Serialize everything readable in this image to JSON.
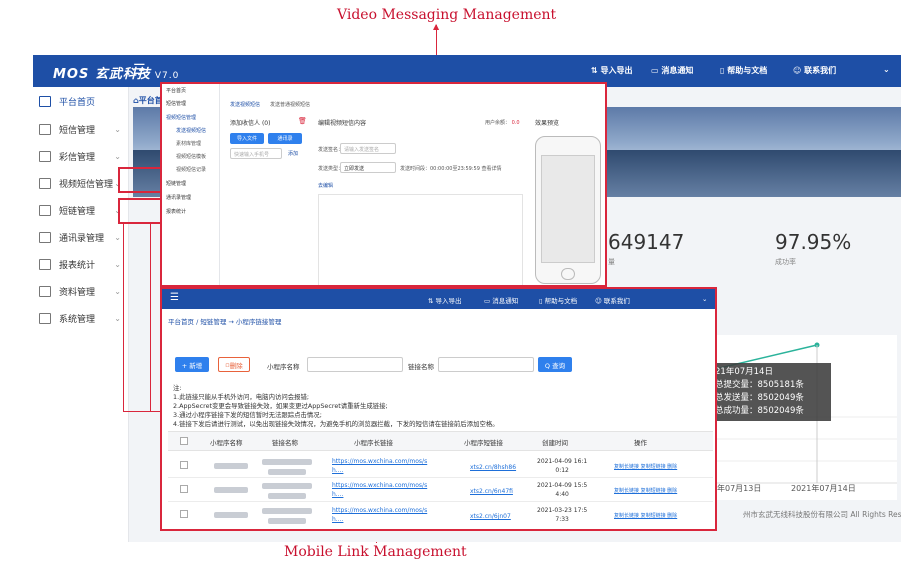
{
  "annotations": {
    "top": "Video Messaging Management",
    "bottom": "Mobile Link Management"
  },
  "app": {
    "logo": "MOS 玄武科技",
    "version": "V7.0",
    "topbar": {
      "export": "导入导出",
      "notice": "消息通知",
      "help": "帮助与文档",
      "contact": "联系我们"
    },
    "sidebar": [
      {
        "label": "平台首页",
        "icon": "home-icon"
      },
      {
        "label": "短信管理",
        "icon": "mail-icon"
      },
      {
        "label": "彩信管理",
        "icon": "image-icon"
      },
      {
        "label": "视频短信管理",
        "icon": "video-icon"
      },
      {
        "label": "短链管理",
        "icon": "link-icon"
      },
      {
        "label": "通讯录管理",
        "icon": "contacts-icon"
      },
      {
        "label": "报表统计",
        "icon": "report-icon"
      },
      {
        "label": "资料管理",
        "icon": "book-icon"
      },
      {
        "label": "系统管理",
        "icon": "folder-icon"
      }
    ],
    "breadcrumb": "平台首",
    "stats": [
      {
        "value": "649147",
        "label": "量"
      },
      {
        "value": "97.95%",
        "label": "成功率"
      }
    ],
    "tooltip": {
      "date": "21年07月14日",
      "sent_total": "总提交量：8505181条",
      "sent": "总发送量：8502049条",
      "success": "总成功量：8502049条"
    },
    "xticks": [
      "年07月13日",
      "2021年07月14日"
    ],
    "footer": "州市玄武无线科技股份有限公司 All Rights Reserved"
  },
  "video_panel": {
    "sidebar": [
      "平台首页",
      "短信管理",
      "视频短信管理",
      "发送视频短信",
      "素材库管理",
      "视频短信模板",
      "视频短信记录",
      "短链管理",
      "通讯录管理",
      "报表统计"
    ],
    "tabs": [
      "发送视频短信",
      "发送普通视频短信"
    ],
    "recipient_title": "添加收信人",
    "recipient_count": "(0)",
    "import_btn": "导入文件",
    "add_btn": "通讯录",
    "recipient_placeholder": "快速输入手机号",
    "recipient_add": "添加",
    "content_title": "编辑视频短信内容",
    "content_hint": "用户余额：",
    "content_hint_value": "0.0",
    "preview_title": "效果预览",
    "sign_label": "发送签名：",
    "sign_placeholder": "请输入发送签名",
    "send_type_label": "发送类型：",
    "send_type_value": "立即发送",
    "time_hint": "发送时间段：00:00:00至23:59:59 查看详情",
    "edit_link": "去编辑"
  },
  "link_panel": {
    "topbar": {
      "export": "导入导出",
      "notice": "消息通知",
      "help": "帮助与文档",
      "contact": "联系我们"
    },
    "breadcrumb": "平台首页 / 短链管理 → 小程序链接管理",
    "buttons": {
      "add": "+ 新增",
      "delete": "删除",
      "search": "Q 查询"
    },
    "filters": {
      "mini_name": "小程序名称",
      "link_name": "链接名称"
    },
    "notes": [
      "注:",
      "1.此链接只能从手机外访问，电脑内访问会报错;",
      "2.AppSecret变更会导致链接失效，如果变更过AppSecret请重新生成链接;",
      "3.通过小程序链接下发的短信暂时无法跟踪点击情况;",
      "4.链接下发后请进行测试，以免出现链接失效情况，为避免手机的浏览器拦截，下发的短信请在链接前后添加空格。"
    ],
    "columns": [
      "小程序名称",
      "链接名称",
      "小程序长链接",
      "小程序短链接",
      "创建时间",
      "操作"
    ],
    "rows": [
      {
        "long": "https://mos.wxchina.com/mos/s",
        "long2": "h....",
        "short": "xts2.cn/8hsh86",
        "time": "2021-04-09 16:1",
        "time2": "0:12",
        "ops": "复制长链接  复制短链接  删除"
      },
      {
        "long": "https://mos.wxchina.com/mos/s",
        "long2": "h....",
        "short": "xts2.cn/6n47fi",
        "time": "2021-04-09 15:5",
        "time2": "4:40",
        "ops": "复制长链接  复制短链接  删除"
      },
      {
        "long": "https://mos.wxchina.com/mos/s",
        "long2": "h....",
        "short": "xts2.cn/6jn07",
        "time": "2021-03-23 17:5",
        "time2": "7:33",
        "ops": "复制长链接  复制短链接  删除"
      }
    ]
  }
}
